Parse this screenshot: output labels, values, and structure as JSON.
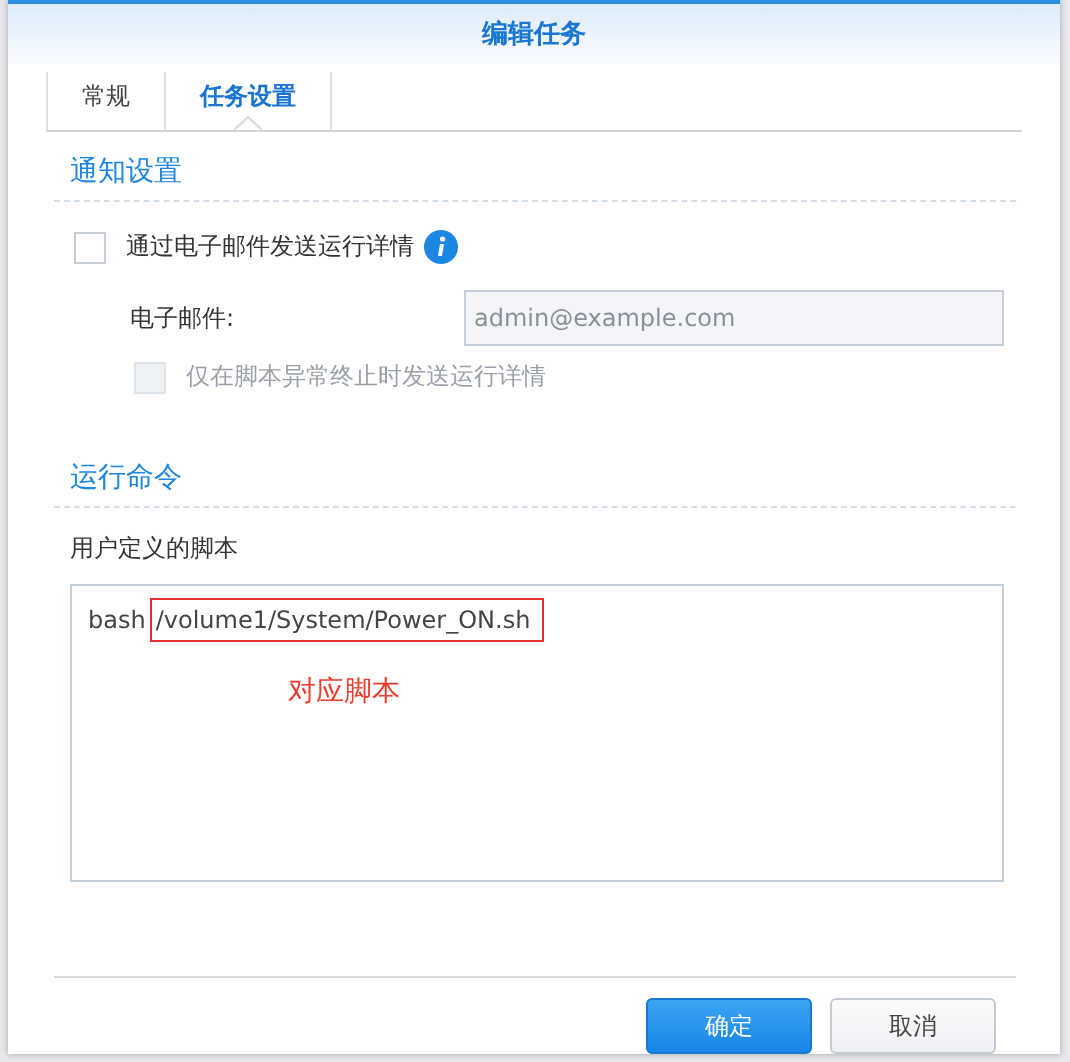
{
  "window": {
    "title": "编辑任务"
  },
  "tabs": [
    {
      "label": "常规",
      "selected": false
    },
    {
      "label": "任务设置",
      "selected": true
    }
  ],
  "notification": {
    "heading": "通知设置",
    "send_email": {
      "label": "通过电子邮件发送运行详情",
      "checked": false,
      "disabled": false
    },
    "email": {
      "label": "电子邮件:",
      "placeholder": "admin@example.com",
      "disabled": true
    },
    "only_on_error": {
      "label": "仅在脚本异常终止时发送运行详情",
      "checked": false,
      "disabled": true
    }
  },
  "run_command": {
    "heading": "运行命令",
    "script_label": "用户定义的脚本",
    "script": {
      "command": "bash",
      "argument": "/volume1/System/Power_ON.sh",
      "highlighted": true
    },
    "annotation": "对应脚本"
  },
  "buttons": [
    {
      "label": "确定",
      "kind": "primary"
    },
    {
      "label": "取消",
      "kind": "secondary"
    }
  ]
}
